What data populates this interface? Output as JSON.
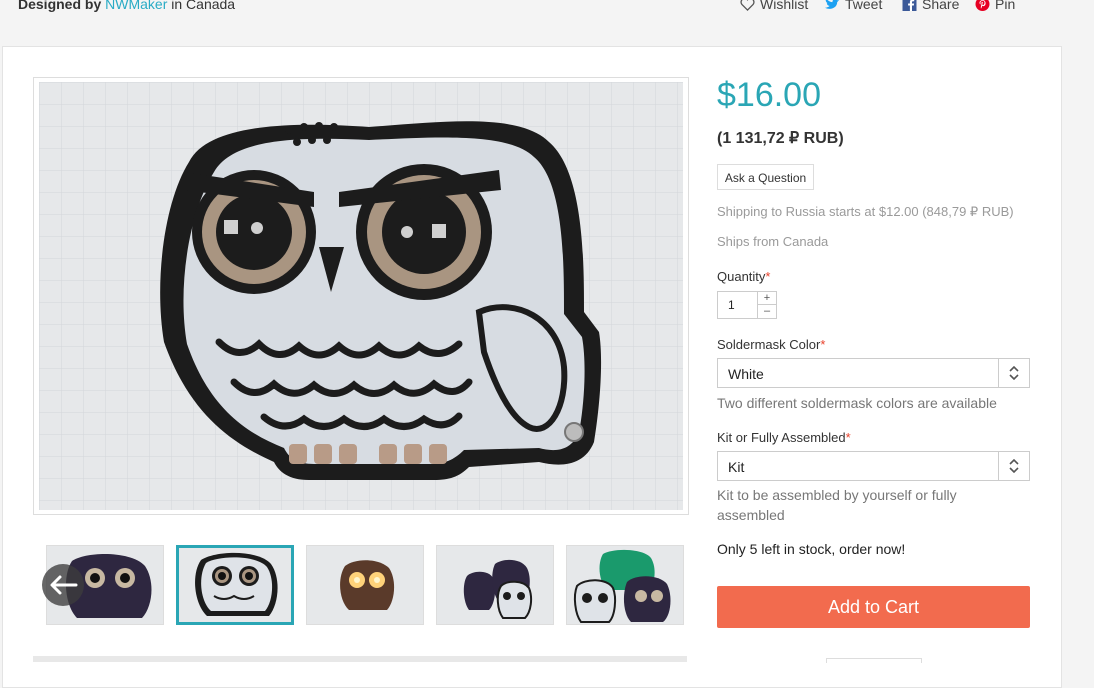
{
  "header": {
    "designed_by_label": "Designed by",
    "maker": "NWMaker",
    "location": "in Canada",
    "wishlist": "Wishlist",
    "tweet": "Tweet",
    "share": "Share",
    "pin": "Pin"
  },
  "product": {
    "price": "$16.00",
    "price_local": "(1 131,72 ₽ RUB)",
    "ask_question": "Ask a Question",
    "shipping": "Shipping to Russia starts at $12.00 (848,79 ₽ RUB)",
    "ships_from": "Ships from Canada",
    "quantity_label": "Quantity",
    "quantity_value": "1",
    "required_mark": "*",
    "soldermask_label": "Soldermask Color",
    "soldermask_value": "White",
    "soldermask_help": "Two different soldermask colors are available",
    "kit_label": "Kit or Fully Assembled",
    "kit_value": "Kit",
    "kit_help_line1": "Kit to be assembled by yourself or fully",
    "kit_help_line2": "assembled",
    "stock": "Only 5 left in stock, order now!",
    "add_to_cart": "Add to Cart"
  },
  "colors": {
    "accent": "#2aa6b5",
    "cart_button": "#f26b4e",
    "required": "#e8402a",
    "owl_white": "#dfe3e8",
    "owl_dark": "#2e2740"
  },
  "icons": {
    "wishlist": "heart-icon",
    "tweet": "twitter-icon",
    "share": "facebook-icon",
    "pin": "pinterest-icon",
    "carousel_prev": "arrow-left-icon",
    "select": "chevron-up-down-icon"
  }
}
